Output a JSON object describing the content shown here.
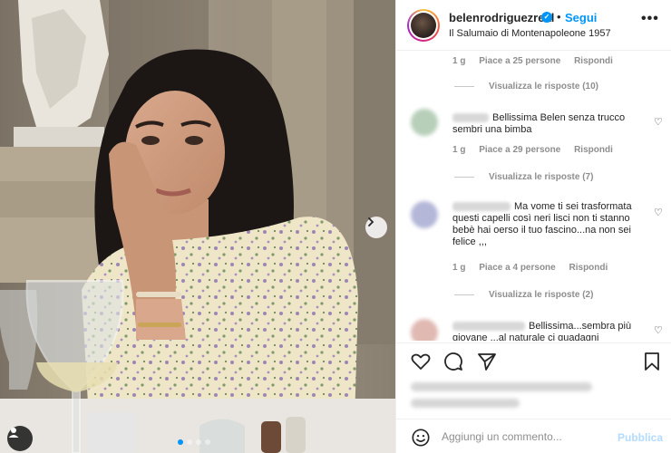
{
  "post": {
    "username": "belenrodriguezreal",
    "separator": "•",
    "follow_label": "Segui",
    "location": "Il Salumaio di Montenapoleone 1957",
    "more_icon": "more-options-icon"
  },
  "comments": [
    {
      "author_hidden": true,
      "text": "",
      "time": "1 g",
      "likes": "Piace a 25 persone",
      "reply": "Rispondi",
      "view_replies": "Visualizza le risposte (10)"
    },
    {
      "author_hidden": true,
      "text": "Bellissima Belen senza trucco sembri una bimba",
      "time": "1 g",
      "likes": "Piace a 29 persone",
      "reply": "Rispondi",
      "view_replies": "Visualizza le risposte (7)"
    },
    {
      "author_hidden": true,
      "text": "Ma vome ti sei trasformata questi capelli così neri lisci non ti stanno bebè hai oerso il tuo fascino...na non sei felice ,,,",
      "time": "1 g",
      "likes": "Piace a 4 persone",
      "reply": "Rispondi",
      "view_replies": "Visualizza le risposte (2)"
    },
    {
      "author_hidden": true,
      "text": "Bellissima...sembra più giovane ...al naturale ci guadagni",
      "time": "",
      "likes": "",
      "reply": "",
      "view_replies": ""
    }
  ],
  "composer": {
    "placeholder": "Aggiungi un commento...",
    "publish_label": "Pubblica"
  },
  "colors": {
    "accent": "#0095f6",
    "publish_disabled": "#b3dbff",
    "muted_text": "#8e8e8e"
  },
  "icons": [
    "heart-icon",
    "comment-icon",
    "share-icon",
    "bookmark-icon",
    "emoji-icon",
    "next-arrow-icon",
    "tag-user-icon",
    "verified-badge-icon"
  ],
  "carousel": {
    "slides": 4,
    "current": 1
  }
}
